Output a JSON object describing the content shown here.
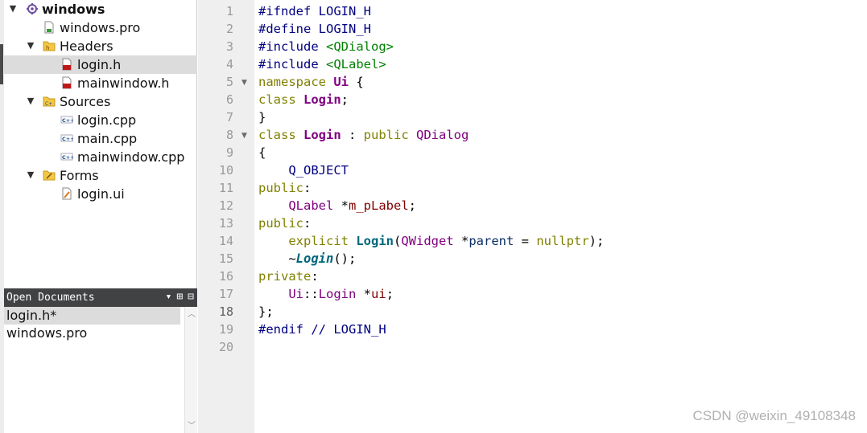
{
  "project_tree": {
    "project": "windows",
    "items": [
      {
        "label": "windows",
        "icon": "project-icon",
        "expanded": true
      },
      {
        "label": "windows.pro",
        "icon": "pro-file-icon"
      },
      {
        "label": "Headers",
        "icon": "headers-folder-icon",
        "expanded": true
      },
      {
        "label": "login.h",
        "icon": "header-file-icon",
        "selected": true
      },
      {
        "label": "mainwindow.h",
        "icon": "header-file-icon"
      },
      {
        "label": "Sources",
        "icon": "sources-folder-icon",
        "expanded": true
      },
      {
        "label": "login.cpp",
        "icon": "cpp-file-icon"
      },
      {
        "label": "main.cpp",
        "icon": "cpp-file-icon"
      },
      {
        "label": "mainwindow.cpp",
        "icon": "cpp-file-icon"
      },
      {
        "label": "Forms",
        "icon": "forms-folder-icon",
        "expanded": true
      },
      {
        "label": "login.ui",
        "icon": "ui-file-icon"
      }
    ]
  },
  "open_documents": {
    "title": "Open Documents",
    "items": [
      "login.h*",
      "windows.pro"
    ]
  },
  "editor": {
    "current_line": 18,
    "line_numbers": [
      "1",
      "2",
      "3",
      "4",
      "5",
      "6",
      "7",
      "8",
      "9",
      "10",
      "11",
      "12",
      "13",
      "14",
      "15",
      "16",
      "17",
      "18",
      "19",
      "20"
    ],
    "lines": [
      [
        [
          "pp",
          "#ifndef LOGIN_H"
        ]
      ],
      [
        [
          "pp",
          "#define LOGIN_H"
        ]
      ],
      [
        [
          "pp",
          "#include "
        ],
        [
          "str",
          "<QDialog>"
        ]
      ],
      [
        [
          "pp",
          "#include "
        ],
        [
          "str",
          "<QLabel>"
        ]
      ],
      [
        [
          "kw",
          "namespace "
        ],
        [
          "typeb",
          "Ui"
        ],
        [
          "plain",
          " {"
        ]
      ],
      [
        [
          "kw",
          "class "
        ],
        [
          "typeb",
          "Login"
        ],
        [
          "plain",
          ";"
        ]
      ],
      [
        [
          "plain",
          "}"
        ]
      ],
      [
        [
          "kw",
          "class "
        ],
        [
          "typeb",
          "Login"
        ],
        [
          "plain",
          " : "
        ],
        [
          "kw",
          "public "
        ],
        [
          "type",
          "QDialog"
        ]
      ],
      [
        [
          "plain",
          "{"
        ]
      ],
      [
        [
          "plain",
          "    "
        ],
        [
          "macro",
          "Q_OBJECT"
        ]
      ],
      [
        [
          "kw",
          "public"
        ],
        [
          "plain",
          ":"
        ]
      ],
      [
        [
          "plain",
          "    "
        ],
        [
          "type",
          "QLabel"
        ],
        [
          "plain",
          " *"
        ],
        [
          "member",
          "m_pLabel"
        ],
        [
          "plain",
          ";"
        ]
      ],
      [
        [
          "kw",
          "public"
        ],
        [
          "plain",
          ":"
        ]
      ],
      [
        [
          "plain",
          "    "
        ],
        [
          "kw",
          "explicit "
        ],
        [
          "func",
          "Login"
        ],
        [
          "plain",
          "("
        ],
        [
          "type",
          "QWidget"
        ],
        [
          "plain",
          " *"
        ],
        [
          "id",
          "parent"
        ],
        [
          "plain",
          " = "
        ],
        [
          "kw",
          "nullptr"
        ],
        [
          "plain",
          ");"
        ]
      ],
      [
        [
          "plain",
          "    ~"
        ],
        [
          "funci",
          "Login"
        ],
        [
          "plain",
          "();"
        ]
      ],
      [
        [
          "kw",
          "private"
        ],
        [
          "plain",
          ":"
        ]
      ],
      [
        [
          "plain",
          "    "
        ],
        [
          "type",
          "Ui"
        ],
        [
          "plain",
          "::"
        ],
        [
          "type",
          "Login"
        ],
        [
          "plain",
          " *"
        ],
        [
          "member",
          "ui"
        ],
        [
          "plain",
          ";"
        ]
      ],
      [
        [
          "plain",
          "};"
        ]
      ],
      [
        [
          "pp",
          "#endif "
        ],
        [
          "comment",
          "// LOGIN_H"
        ]
      ],
      [
        [
          "plain",
          ""
        ]
      ]
    ],
    "fold_lines": [
      5,
      8
    ]
  },
  "watermark": "CSDN @weixin_49108348"
}
